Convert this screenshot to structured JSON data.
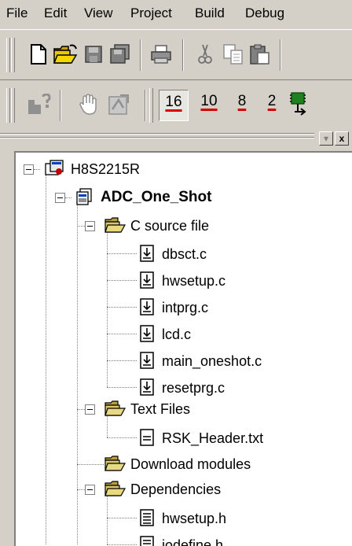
{
  "menu": {
    "items": [
      "File",
      "Edit",
      "View",
      "Project",
      "Build",
      "Debug"
    ]
  },
  "toolbar_radix": {
    "items": [
      {
        "label": "16",
        "pressed": true
      },
      {
        "label": "10",
        "pressed": false
      },
      {
        "label": "8",
        "pressed": false
      },
      {
        "label": "2",
        "pressed": false
      }
    ]
  },
  "panel": {
    "restore_label": "▾",
    "close_label": "x"
  },
  "tree": {
    "workspace": "H8S2215R",
    "project": "ADC_One_Shot",
    "folders": {
      "c_source": "C source file",
      "text_files": "Text Files",
      "download_modules": "Download modules",
      "dependencies": "Dependencies"
    },
    "c_files": [
      "dbsct.c",
      "hwsetup.c",
      "intprg.c",
      "lcd.c",
      "main_oneshot.c",
      "resetprg.c"
    ],
    "text_files": [
      "RSK_Header.txt"
    ],
    "dependencies": [
      "hwsetup.h",
      "iodefine.h"
    ]
  },
  "colors": {
    "chrome": "#d4d0c8",
    "folder": "#d8c86a",
    "radix_underline": "#d40000"
  }
}
